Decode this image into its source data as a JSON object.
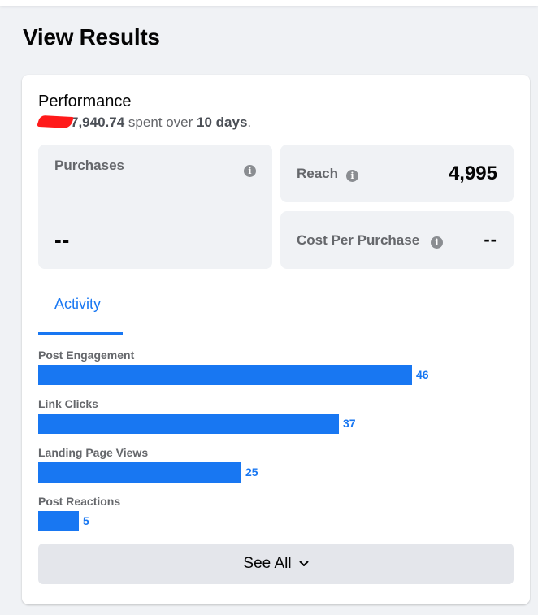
{
  "page": {
    "title": "View Results"
  },
  "performance": {
    "title": "Performance",
    "amount_spent_visible": "7,940.74",
    "amount_redacted": true,
    "spent_text": " spent over ",
    "duration": "10 days",
    "period": "."
  },
  "metrics": {
    "purchases": {
      "label": "Purchases",
      "value": "--",
      "icon": "info-icon"
    },
    "reach": {
      "label": "Reach",
      "value": "4,995",
      "icon": "info-icon"
    },
    "cost_per_purchase": {
      "label": "Cost Per Purchase",
      "value": "--",
      "icon": "info-icon"
    }
  },
  "tabs": [
    {
      "label": "Activity",
      "active": true
    }
  ],
  "activity": {
    "max_value": 56,
    "items": [
      {
        "label": "Post Engagement",
        "value": 46
      },
      {
        "label": "Link Clicks",
        "value": 37
      },
      {
        "label": "Landing Page Views",
        "value": 25
      },
      {
        "label": "Post Reactions",
        "value": 5
      }
    ]
  },
  "see_all": {
    "label": "See All",
    "icon": "chevron-down-icon"
  },
  "colors": {
    "accent": "#1877f2",
    "background": "#f0f2f5",
    "card": "#ffffff",
    "metric_tile": "#f0f2f5",
    "secondary_text": "#65676b",
    "button_bg": "#e4e6eb",
    "redaction": "#ff1a1a"
  }
}
